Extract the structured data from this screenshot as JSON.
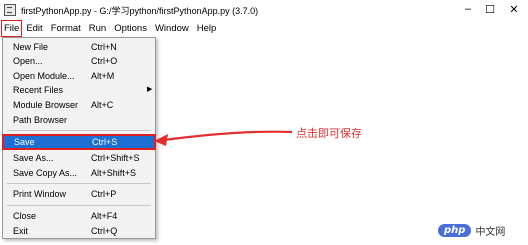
{
  "window": {
    "title": "firstPythonApp.py - G:/学习python/firstPythonApp.py (3.7.0)",
    "minimize": "–",
    "maximize": "☐",
    "close": "✕"
  },
  "menubar": [
    "File",
    "Edit",
    "Format",
    "Run",
    "Options",
    "Window",
    "Help"
  ],
  "file_menu": {
    "items": [
      {
        "label": "New File",
        "accel": "Ctrl+N"
      },
      {
        "label": "Open...",
        "accel": "Ctrl+O"
      },
      {
        "label": "Open Module...",
        "accel": "Alt+M"
      },
      {
        "label": "Recent Files",
        "accel": "",
        "submenu": "▶"
      },
      {
        "label": "Module Browser",
        "accel": "Alt+C"
      },
      {
        "label": "Path Browser",
        "accel": ""
      },
      {
        "label": "Save",
        "accel": "Ctrl+S"
      },
      {
        "label": "Save As...",
        "accel": "Ctrl+Shift+S"
      },
      {
        "label": "Save Copy As...",
        "accel": "Alt+Shift+S"
      },
      {
        "label": "Print Window",
        "accel": "Ctrl+P"
      },
      {
        "label": "Close",
        "accel": "Alt+F4"
      },
      {
        "label": "Exit",
        "accel": "Ctrl+Q"
      }
    ],
    "selected": "Save"
  },
  "annotation": {
    "text": "点击即可保存",
    "color": "#e03030"
  },
  "watermark": {
    "logo": "php",
    "text": "中文网"
  },
  "colors": {
    "highlight": "#1e6fd4",
    "annotation_red": "#e02020"
  }
}
